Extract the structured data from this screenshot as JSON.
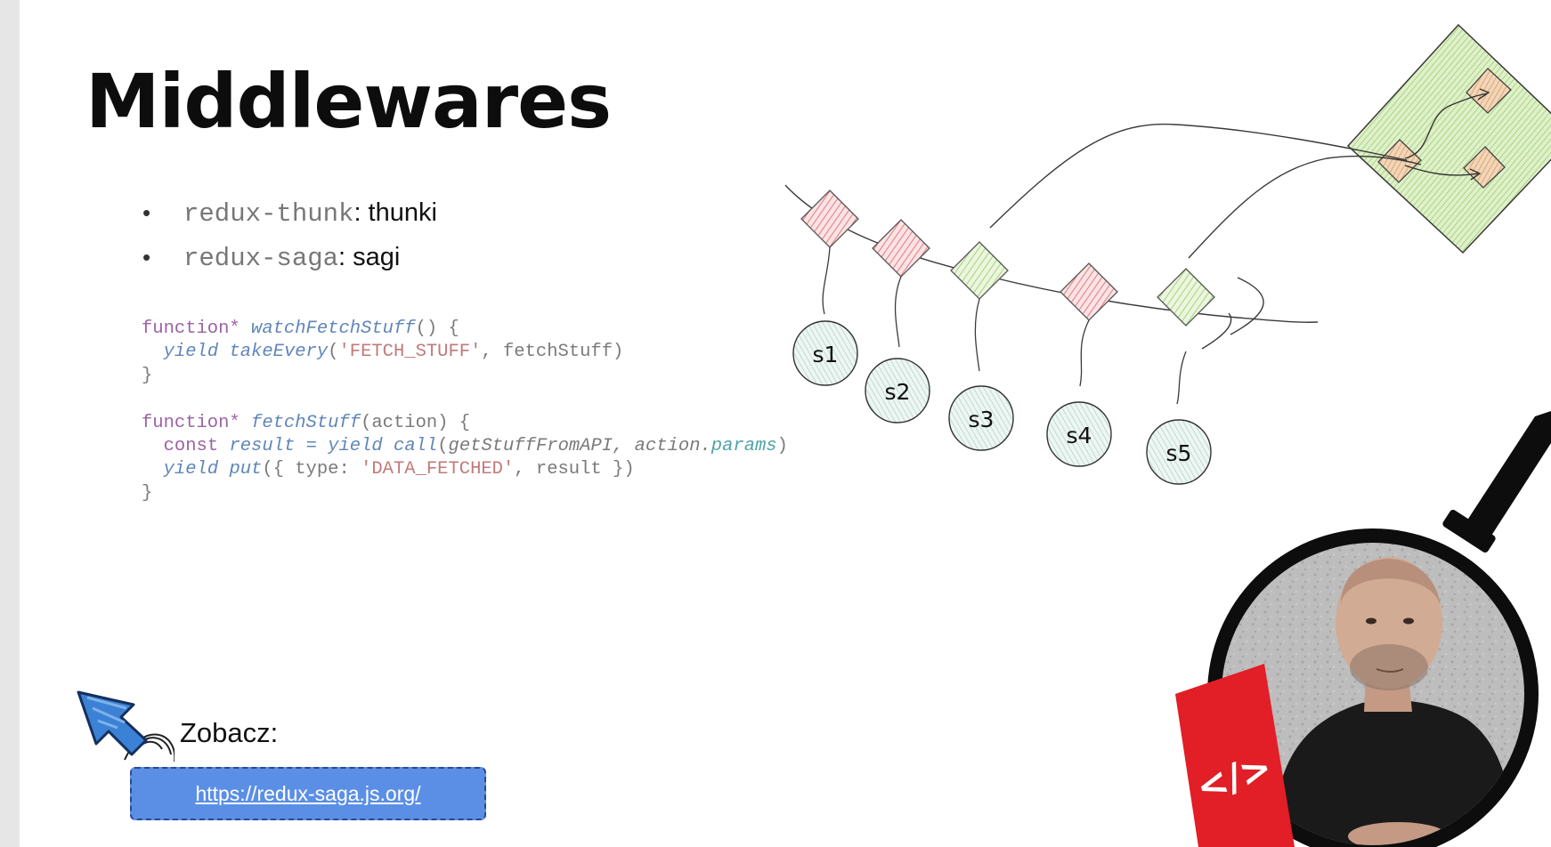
{
  "slide": {
    "title": "Middlewares",
    "bullets": [
      {
        "code": "redux-thunk",
        "text": ": thunki"
      },
      {
        "code": "redux-saga",
        "text": ": sagi"
      }
    ],
    "code_lines": [
      "function* watchFetchStuff() {",
      "  yield takeEvery('FETCH_STUFF', fetchStuff)",
      "}",
      "",
      "function* fetchStuff(action) {",
      "  const result = yield call(getStuffFromAPI, action.params)",
      "  yield put({ type: 'DATA_FETCHED', result })",
      "}"
    ],
    "diagram": {
      "sagas": [
        "s1",
        "s2",
        "s3",
        "s4",
        "s5"
      ],
      "colors": {
        "red_diamond": "#f2a0a6",
        "green_diamond": "#c9e7a6",
        "store": "#bfe49b",
        "circle": "#d9ece7"
      }
    },
    "see": {
      "label": "Zobacz:",
      "url": "https://redux-saga.js.org/"
    },
    "badge": {
      "icon": "code-icon",
      "color": "#e21e26"
    },
    "accent_color": "#5b8fe6"
  }
}
